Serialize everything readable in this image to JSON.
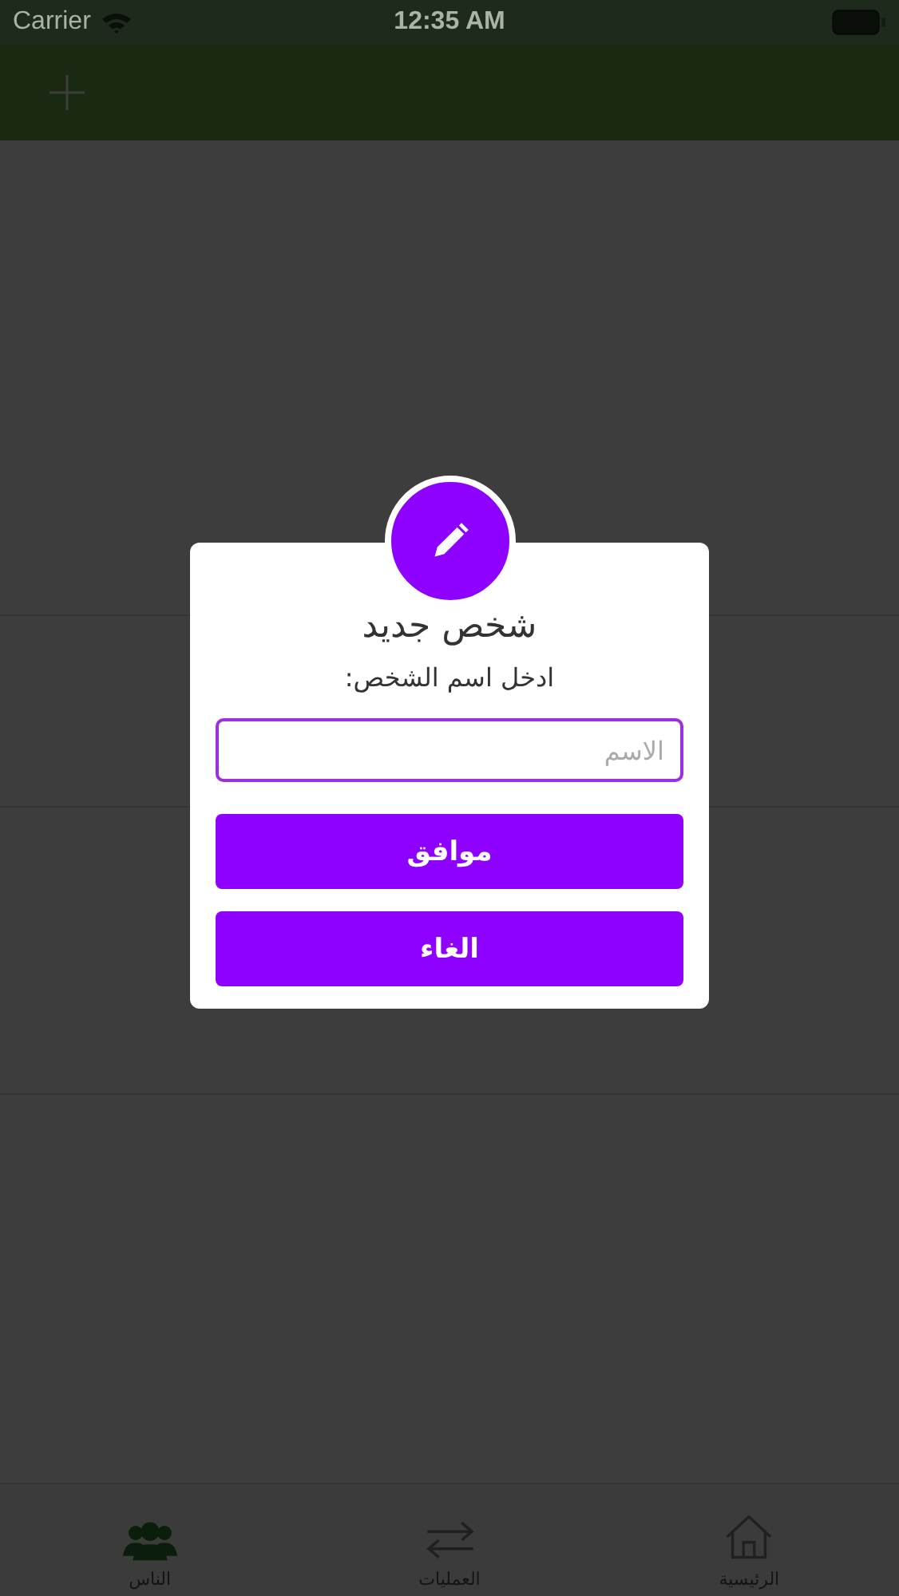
{
  "status_bar": {
    "carrier": "Carrier",
    "time": "12:35 AM"
  },
  "dialog": {
    "title": "شخص جديد",
    "message": "ادخل اسم الشخص:",
    "name_field": {
      "placeholder": "الاسم"
    },
    "buttons": [
      "موافق",
      "الغاء"
    ]
  },
  "tabs": [
    {
      "label": "الرئيسية",
      "selected": false
    },
    {
      "label": "العمليات",
      "selected": false
    },
    {
      "label": "الناس",
      "selected": true
    }
  ]
}
